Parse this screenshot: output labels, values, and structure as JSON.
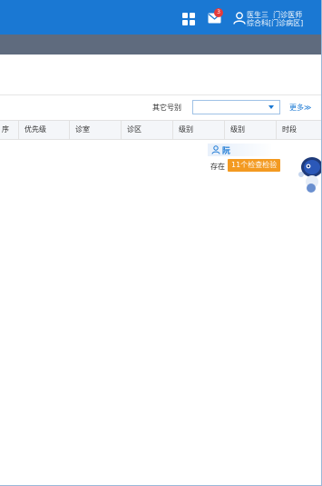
{
  "header": {
    "mail_badge_count": "3",
    "user_name": "医生三",
    "user_role": "门诊医师",
    "user_dept": "综合科[门诊病区]",
    "bg_color": "#1a78d3",
    "icons": [
      "apps-grid-icon",
      "mail-icon",
      "user-icon"
    ]
  },
  "filter": {
    "label": "其它号别",
    "select_value": "",
    "more_label": "更多≫"
  },
  "table": {
    "columns": [
      "序",
      "优先级",
      "诊室",
      "诊区",
      "级别",
      "级别",
      "时段"
    ]
  },
  "row": {
    "patient_name": "阮",
    "status_text": "存在",
    "tag_text": "11个检查检验",
    "tag_color": "#f39a21"
  }
}
